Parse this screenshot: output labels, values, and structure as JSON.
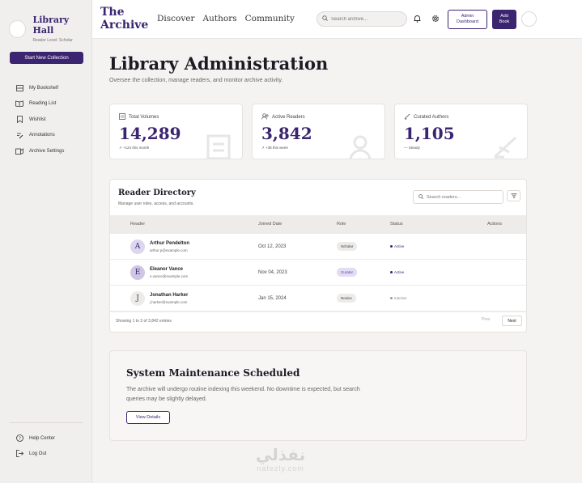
{
  "sidebar": {
    "brand_title": "Library Hall",
    "brand_subtitle": "Reader Level: Scholar",
    "new_collection": "Start New Collection",
    "items": [
      {
        "label": "My Bookshelf",
        "icon": "bookshelf-icon"
      },
      {
        "label": "Reading List",
        "icon": "book-open-icon"
      },
      {
        "label": "Wishlist",
        "icon": "bookmark-icon"
      },
      {
        "label": "Annotations",
        "icon": "edit-icon"
      },
      {
        "label": "Archive Settings",
        "icon": "archive-icon"
      }
    ],
    "footer": [
      {
        "label": "Help Center",
        "icon": "help-icon"
      },
      {
        "label": "Log Out",
        "icon": "logout-icon"
      }
    ]
  },
  "header": {
    "logo_line1": "The",
    "logo_line2": "Archive",
    "nav": [
      "Discover",
      "Authors",
      "Community"
    ],
    "search_placeholder": "Search archive...",
    "admin_line1": "Admin",
    "admin_line2": "Dashboard",
    "add_line1": "Add",
    "add_line2": "Book"
  },
  "main": {
    "title": "Library Administration",
    "subtitle": "Oversee the collection, manage readers, and monitor archive activity."
  },
  "stats": [
    {
      "label": "Total Volumes",
      "value": "14,289",
      "delta": "+124 this month",
      "icon": "volumes-icon"
    },
    {
      "label": "Active Readers",
      "value": "3,842",
      "delta": "+38 this week",
      "icon": "readers-icon"
    },
    {
      "label": "Curated Authors",
      "value": "1,105",
      "delta": "Steady",
      "icon": "authors-icon"
    }
  ],
  "directory": {
    "title": "Reader Directory",
    "subtitle": "Manage user roles, access, and accounts.",
    "search_placeholder": "Search readers...",
    "columns": [
      "Reader",
      "Joined Date",
      "Role",
      "Status",
      "Actions"
    ],
    "rows": [
      {
        "initial": "A",
        "name": "Arthur Pendelton",
        "email": "arthur.p@example.com",
        "date": "Oct 12, 2023",
        "role": "Scholar",
        "status": "Active"
      },
      {
        "initial": "E",
        "name": "Eleanor Vance",
        "email": "e.vance@example.com",
        "date": "Nov 04, 2023",
        "role": "Curator",
        "status": "Active"
      },
      {
        "initial": "J",
        "name": "Jonathan Harker",
        "email": "j.harker@example.com",
        "date": "Jan 15, 2024",
        "role": "Novice",
        "status": "Inactive"
      }
    ],
    "showing": "Showing 1 to 3 of 3,842 entries",
    "prev": "Prev",
    "next": "Next"
  },
  "maintenance": {
    "title": "System Maintenance Scheduled",
    "text": "The archive will undergo routine indexing this weekend. No downtime is expected, but search queries may be slightly delayed.",
    "button": "View Details"
  },
  "watermark": {
    "arabic": "نفذلي",
    "latin": "nafezly.com"
  },
  "colors": {
    "accent": "#3b2470",
    "active_status": "#3b2470",
    "inactive_status": "#999999"
  }
}
